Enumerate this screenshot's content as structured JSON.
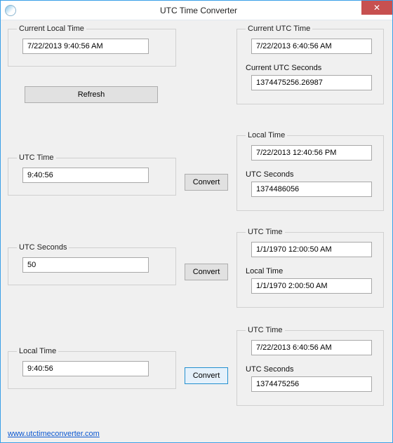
{
  "window": {
    "title": "UTC Time Converter",
    "close": "✕"
  },
  "left": {
    "current_local_time": {
      "legend": "Current Local Time",
      "value": "7/22/2013 9:40:56 AM"
    },
    "refresh_label": "Refresh",
    "utc_time": {
      "legend": "UTC Time",
      "value": "9:40:56"
    },
    "utc_seconds": {
      "legend": "UTC Seconds",
      "value": "50"
    },
    "local_time": {
      "legend": "Local Time",
      "value": "9:40:56"
    }
  },
  "buttons": {
    "convert1": "Convert",
    "convert2": "Convert",
    "convert3": "Convert"
  },
  "right": {
    "current_utc_time": {
      "label": "Current UTC Time",
      "value": "7/22/2013 6:40:56 AM"
    },
    "current_utc_seconds": {
      "label": "Current UTC Seconds",
      "value": "1374475256.26987"
    },
    "r1_local_time": {
      "label": "Local Time",
      "value": "7/22/2013 12:40:56 PM"
    },
    "r1_utc_seconds": {
      "label": "UTC Seconds",
      "value": "1374486056"
    },
    "r2_utc_time": {
      "label": "UTC Time",
      "value": "1/1/1970 12:00:50 AM"
    },
    "r2_local_time": {
      "label": "Local Time",
      "value": "1/1/1970 2:00:50 AM"
    },
    "r3_utc_time": {
      "label": "UTC Time",
      "value": "7/22/2013 6:40:56 AM"
    },
    "r3_utc_seconds": {
      "label": "UTC Seconds",
      "value": "1374475256"
    }
  },
  "footer": {
    "link_text": "www.utctimeconverter.com"
  }
}
